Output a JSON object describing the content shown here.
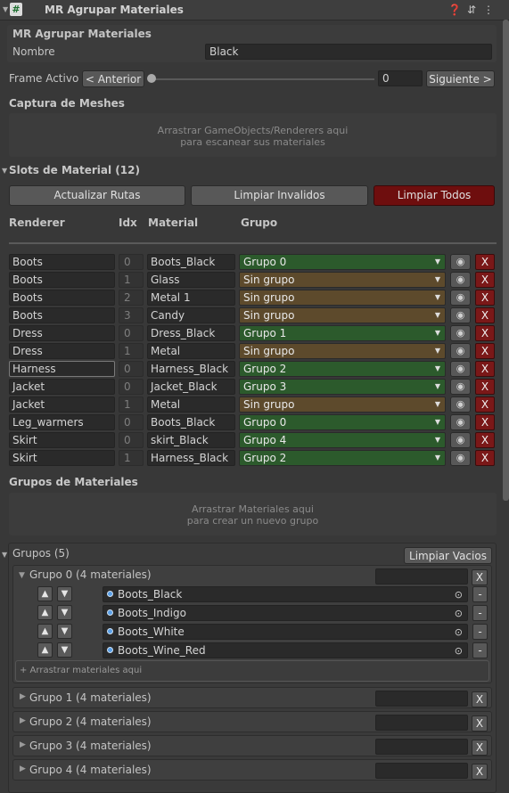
{
  "header": {
    "title": "MR Agrupar Materiales",
    "icons": [
      "help-icon",
      "settings-sliders-icon",
      "more-options-icon"
    ]
  },
  "inspector": {
    "title": "MR Agrupar Materiales",
    "name_label": "Nombre",
    "name_value": "Black"
  },
  "frame": {
    "label": "Frame Activo",
    "prev_label": "< Anterior",
    "value": "0",
    "next_label": "Siguiente >",
    "slider_fraction": 0
  },
  "capture": {
    "title": "Captura de Meshes",
    "drop_line1": "Arrastrar GameObjects/Renderers aqui",
    "drop_line2": "para escanear sus materiales"
  },
  "slots": {
    "title": "Slots de Material (12)",
    "update_label": "Actualizar Rutas",
    "clean_invalid_label": "Limpiar Invalidos",
    "clean_all_label": "Limpiar Todos",
    "columns": [
      "Renderer",
      "Idx",
      "Material",
      "Grupo"
    ],
    "x_label": "X",
    "rows": [
      {
        "renderer": "Boots",
        "idx": "0",
        "material": "Boots_Black",
        "group": "Grupo 0",
        "assigned": true
      },
      {
        "renderer": "Boots",
        "idx": "1",
        "material": "Glass",
        "group": "Sin grupo",
        "assigned": false
      },
      {
        "renderer": "Boots",
        "idx": "2",
        "material": "Metal 1",
        "group": "Sin grupo",
        "assigned": false
      },
      {
        "renderer": "Boots",
        "idx": "3",
        "material": "Candy",
        "group": "Sin grupo",
        "assigned": false
      },
      {
        "renderer": "Dress",
        "idx": "0",
        "material": "Dress_Black",
        "group": "Grupo 1",
        "assigned": true
      },
      {
        "renderer": "Dress",
        "idx": "1",
        "material": "Metal",
        "group": "Sin grupo",
        "assigned": false
      },
      {
        "renderer": "Harness",
        "idx": "0",
        "material": "Harness_Black",
        "group": "Grupo 2",
        "assigned": true
      },
      {
        "renderer": "Jacket",
        "idx": "0",
        "material": "Jacket_Black",
        "group": "Grupo 3",
        "assigned": true
      },
      {
        "renderer": "Jacket",
        "idx": "1",
        "material": "Metal",
        "group": "Sin grupo",
        "assigned": false
      },
      {
        "renderer": "Leg_warmers",
        "idx": "0",
        "material": "Boots_Black",
        "group": "Grupo 0",
        "assigned": true
      },
      {
        "renderer": "Skirt",
        "idx": "0",
        "material": "skirt_Black",
        "group": "Grupo 4",
        "assigned": true
      },
      {
        "renderer": "Skirt",
        "idx": "1",
        "material": "Harness_Black",
        "group": "Grupo 2",
        "assigned": true
      }
    ]
  },
  "material_groups": {
    "title": "Grupos de Materiales",
    "drop_line1": "Arrastrar Materiales aqui",
    "drop_line2": "para crear un nuevo grupo"
  },
  "groups": {
    "title": "Grupos (5)",
    "clean_empty_label": "Limpiar Vacios",
    "x_label": "X",
    "minus_label": "-",
    "expanded": {
      "title": "Grupo 0 (4 materiales)",
      "materials": [
        "Boots_Black",
        "Boots_Indigo",
        "Boots_White",
        "Boots_Wine_Red"
      ],
      "drop_hint": "+ Arrastrar materiales aqui"
    },
    "collapsed": [
      "Grupo 1 (4 materiales)",
      "Grupo 2 (4 materiales)",
      "Grupo 3 (4 materiales)",
      "Grupo 4 (4 materiales)"
    ]
  },
  "colors": {
    "assigned": "#2c5a2c",
    "unassigned": "#5d4a2c",
    "danger": "#7a1818"
  }
}
